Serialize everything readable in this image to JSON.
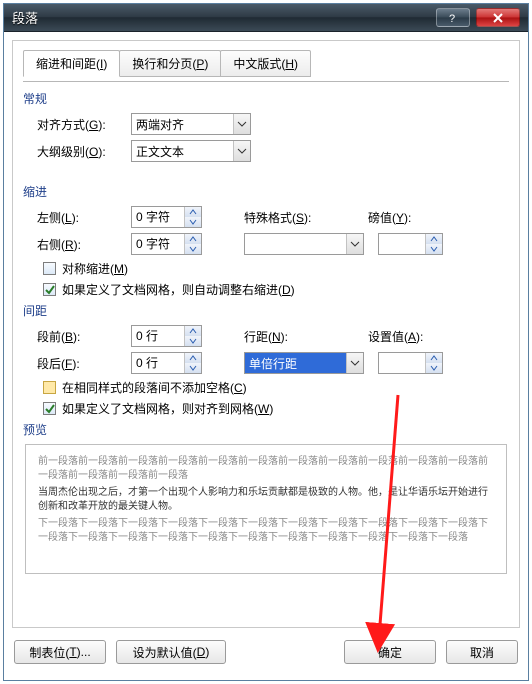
{
  "window": {
    "title": "段落"
  },
  "tabs": {
    "indent": {
      "label_pre": "缩进和间距(",
      "key": "I",
      "label_post": ")"
    },
    "pagination": {
      "label_pre": "换行和分页(",
      "key": "P",
      "label_post": ")"
    },
    "cjk": {
      "label_pre": "中文版式(",
      "key": "H",
      "label_post": ")"
    }
  },
  "general": {
    "title": "常规",
    "align_label_pre": "对齐方式(",
    "align_key": "G",
    "align_label_post": "):",
    "align_value": "两端对齐",
    "outline_label_pre": "大纲级别(",
    "outline_key": "O",
    "outline_label_post": "):",
    "outline_value": "正文文本"
  },
  "indent": {
    "title": "缩进",
    "left_label_pre": "左侧(",
    "left_key": "L",
    "left_label_post": "):",
    "left_value": "0 字符",
    "right_label_pre": "右侧(",
    "right_key": "R",
    "right_label_post": "):",
    "right_value": "0 字符",
    "special_label_pre": "特殊格式(",
    "special_key": "S",
    "special_label_post": "):",
    "special_value": "",
    "by_label_pre": "磅值(",
    "by_key": "Y",
    "by_label_post": "):",
    "by_value": "",
    "mirror_label_pre": "对称缩进(",
    "mirror_key": "M",
    "mirror_label_post": ")",
    "autogrid_label_pre": "如果定义了文档网格，则自动调整右缩进(",
    "autogrid_key": "D",
    "autogrid_label_post": ")"
  },
  "spacing": {
    "title": "间距",
    "before_label_pre": "段前(",
    "before_key": "B",
    "before_label_post": "):",
    "before_value": "0 行",
    "after_label_pre": "段后(",
    "after_key": "F",
    "after_label_post": "):",
    "after_value": "0 行",
    "linespace_label_pre": "行距(",
    "linespace_key": "N",
    "linespace_label_post": "):",
    "linespace_value": "单倍行距",
    "setat_label_pre": "设置值(",
    "setat_key": "A",
    "setat_label_post": "):",
    "setat_value": "",
    "nospace_label_pre": "在相同样式的段落间不添加空格(",
    "nospace_key": "C",
    "nospace_label_post": ")",
    "snapgrid_label_pre": "如果定义了文档网格，则对齐到网格(",
    "snapgrid_key": "W",
    "snapgrid_label_post": ")"
  },
  "preview": {
    "title": "预览",
    "filler_before": "前一段落前一段落前一段落前一段落前一段落前一段落前一段落前一段落前一段落前一段落前一段落前一段落前一段落前一段落前一段落",
    "sample": "当周杰伦出现之后，才第一个出现个人影响力和乐坛贡献都是极致的人物。他，是让华语乐坛开始进行创新和改革开放的最关键人物。",
    "filler_after": "下一段落下一段落下一段落下一段落下一段落下一段落下一段落下一段落下一段落下一段落下一段落下一段落下一段落下一段落下一段落下一段落下一段落下一段落下一段落下一段落下一段落下一段落"
  },
  "buttons": {
    "tabs_label_pre": "制表位(",
    "tabs_key": "T",
    "tabs_label_post": ")...",
    "default_label_pre": "设为默认值(",
    "default_key": "D",
    "default_label_post": ")",
    "ok": "确定",
    "cancel": "取消"
  }
}
